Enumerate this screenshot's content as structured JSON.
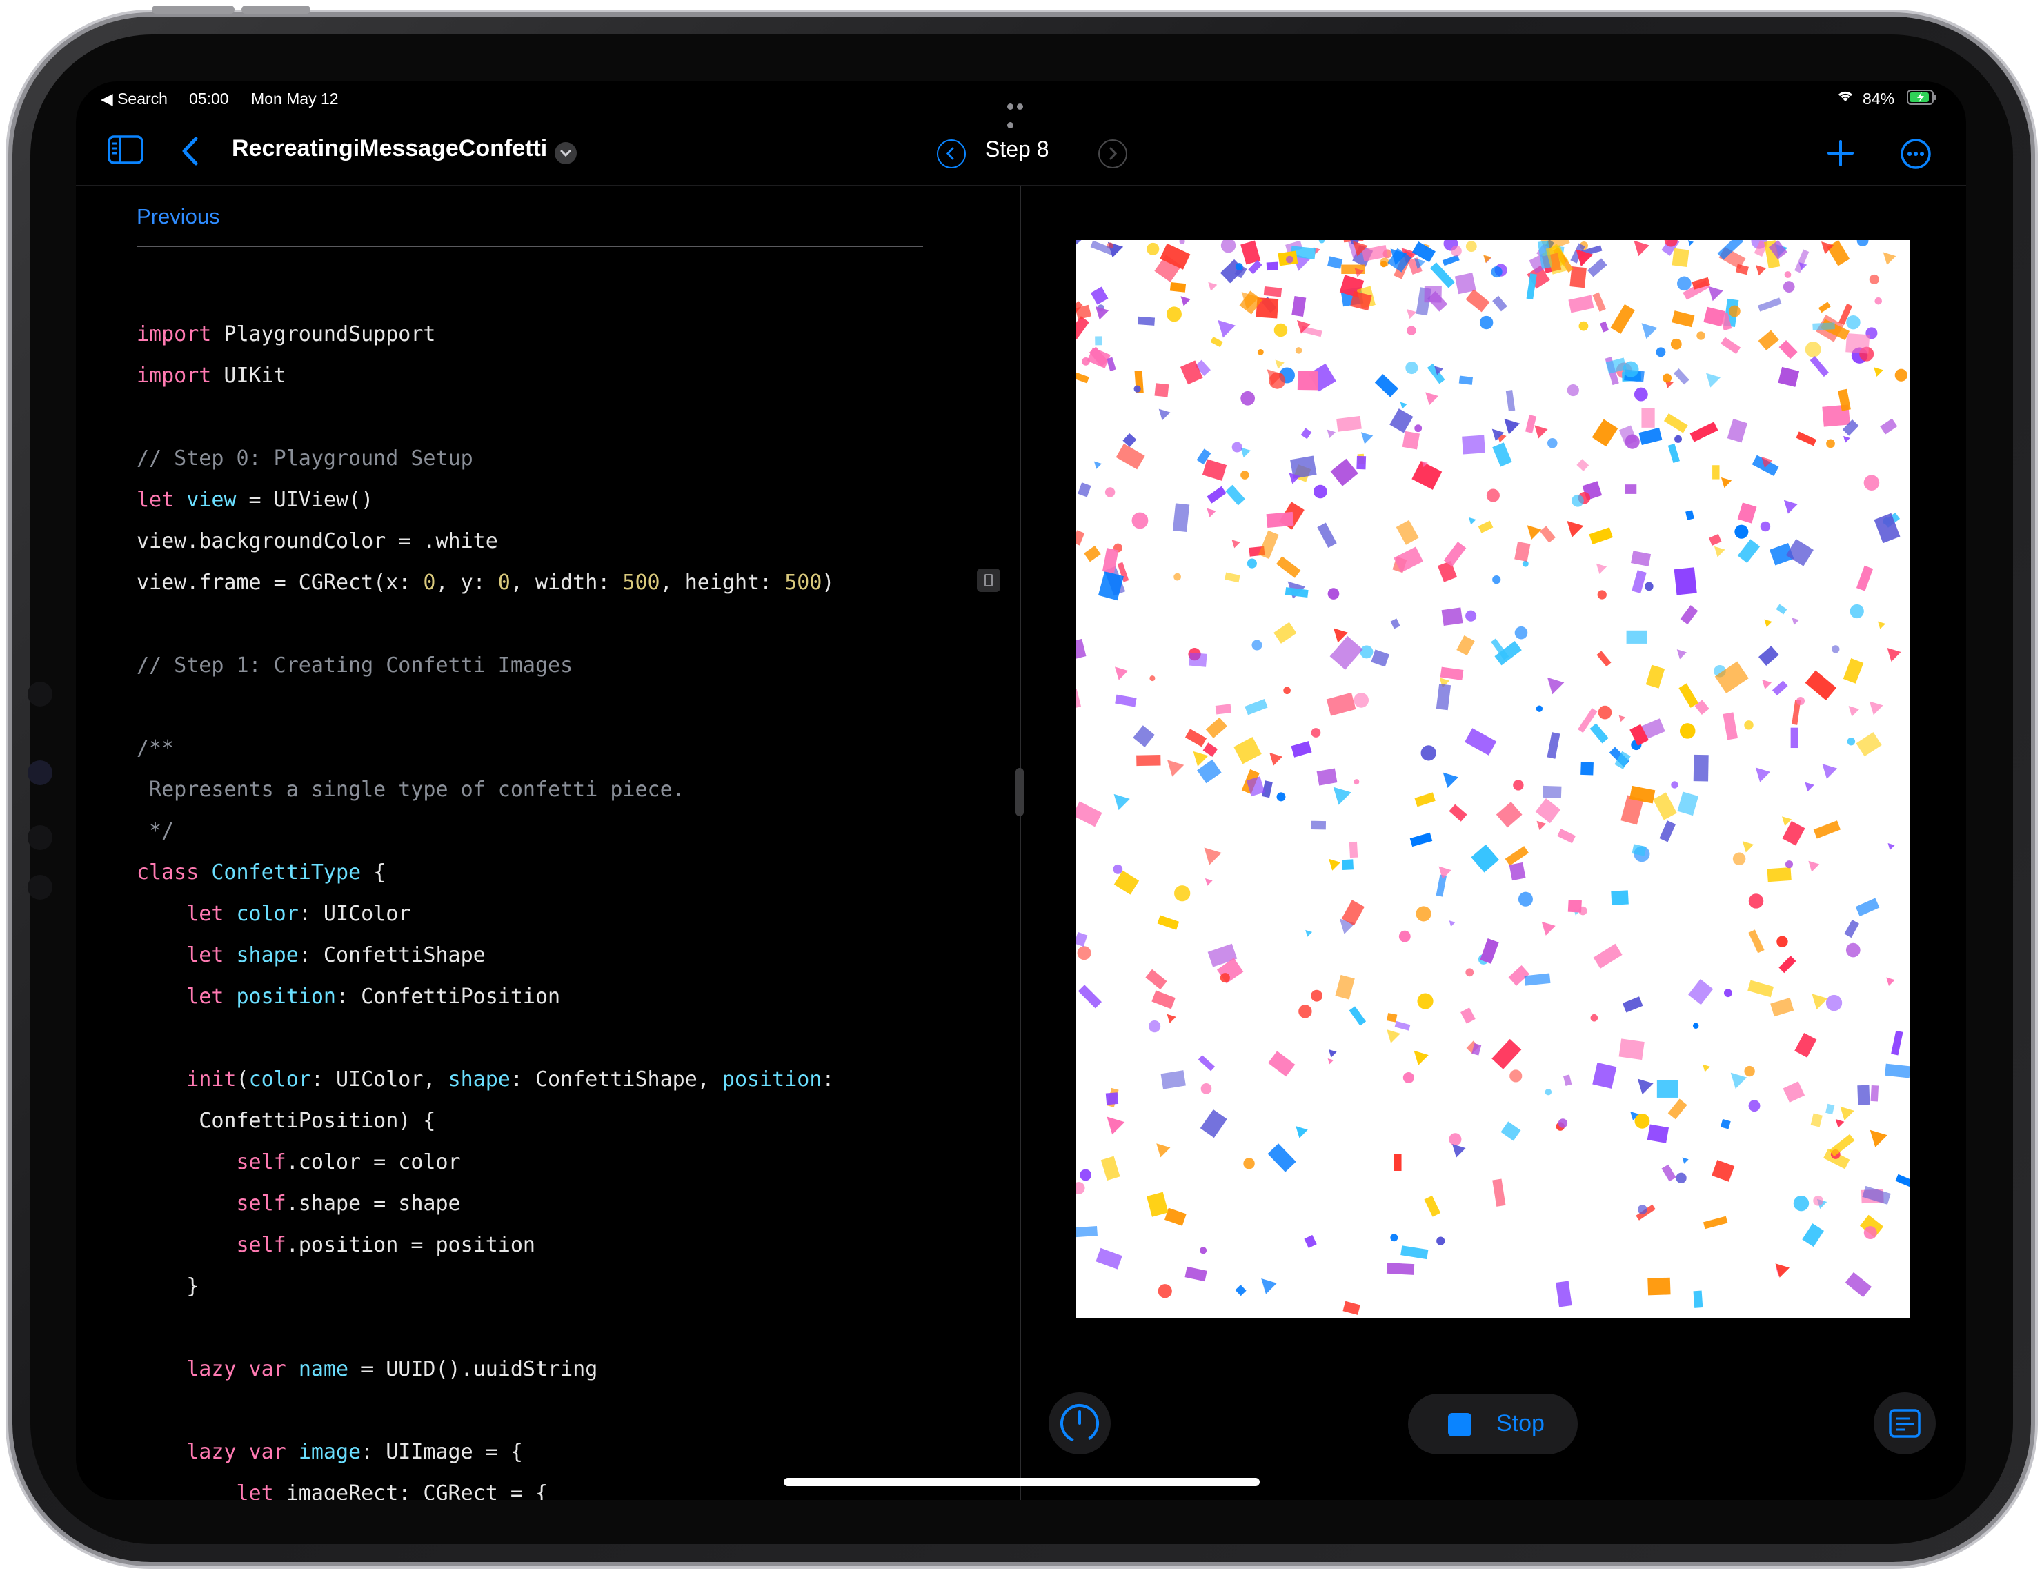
{
  "status_bar": {
    "back_app": "Search",
    "time": "05:00",
    "date": "Mon May 12",
    "battery": "84%"
  },
  "nav": {
    "title": "RecreatingiMessageConfetti",
    "step": "Step 8"
  },
  "editor": {
    "previous_link": "Previous",
    "lines": [
      [
        [
          "kw",
          "import"
        ],
        [
          "plain",
          " PlaygroundSupport"
        ]
      ],
      [
        [
          "kw",
          "import"
        ],
        [
          "plain",
          " UIKit"
        ]
      ],
      [],
      [
        [
          "cm",
          "// Step 0: Playground Setup"
        ]
      ],
      [
        [
          "kw",
          "let"
        ],
        [
          "plain",
          " "
        ],
        [
          "id",
          "view"
        ],
        [
          "plain",
          " = UIView()"
        ]
      ],
      [
        [
          "plain",
          "view.backgroundColor = .white"
        ]
      ],
      [
        [
          "plain",
          "view.frame = CGRect(x: "
        ],
        [
          "num",
          "0"
        ],
        [
          "plain",
          ", y: "
        ],
        [
          "num",
          "0"
        ],
        [
          "plain",
          ", width: "
        ],
        [
          "num",
          "500"
        ],
        [
          "plain",
          ", height: "
        ],
        [
          "num",
          "500"
        ],
        [
          "plain",
          ")"
        ]
      ],
      [],
      [
        [
          "cm",
          "// Step 1: Creating Confetti Images"
        ]
      ],
      [],
      [
        [
          "cm",
          "/**"
        ]
      ],
      [
        [
          "cm",
          " Represents a single type of confetti piece."
        ]
      ],
      [
        [
          "cm",
          " */"
        ]
      ],
      [
        [
          "kw",
          "class"
        ],
        [
          "plain",
          " "
        ],
        [
          "id",
          "ConfettiType"
        ],
        [
          "plain",
          " {"
        ]
      ],
      [
        [
          "plain",
          "    "
        ],
        [
          "kw",
          "let"
        ],
        [
          "plain",
          " "
        ],
        [
          "id",
          "color"
        ],
        [
          "plain",
          ": UIColor"
        ]
      ],
      [
        [
          "plain",
          "    "
        ],
        [
          "kw",
          "let"
        ],
        [
          "plain",
          " "
        ],
        [
          "id",
          "shape"
        ],
        [
          "plain",
          ": ConfettiShape"
        ]
      ],
      [
        [
          "plain",
          "    "
        ],
        [
          "kw",
          "let"
        ],
        [
          "plain",
          " "
        ],
        [
          "id",
          "position"
        ],
        [
          "plain",
          ": ConfettiPosition"
        ]
      ],
      [],
      [
        [
          "plain",
          "    "
        ],
        [
          "kw",
          "init"
        ],
        [
          "plain",
          "("
        ],
        [
          "id",
          "color"
        ],
        [
          "plain",
          ": UIColor, "
        ],
        [
          "id",
          "shape"
        ],
        [
          "plain",
          ": ConfettiShape, "
        ],
        [
          "id",
          "position"
        ],
        [
          "plain",
          ":"
        ]
      ],
      [
        [
          "plain",
          "     ConfettiPosition) {"
        ]
      ],
      [
        [
          "plain",
          "        "
        ],
        [
          "kw",
          "self"
        ],
        [
          "plain",
          ".color = color"
        ]
      ],
      [
        [
          "plain",
          "        "
        ],
        [
          "kw",
          "self"
        ],
        [
          "plain",
          ".shape = shape"
        ]
      ],
      [
        [
          "plain",
          "        "
        ],
        [
          "kw",
          "self"
        ],
        [
          "plain",
          ".position = position"
        ]
      ],
      [
        [
          "plain",
          "    }"
        ]
      ],
      [],
      [
        [
          "plain",
          "    "
        ],
        [
          "kw",
          "lazy"
        ],
        [
          "plain",
          " "
        ],
        [
          "kw",
          "var"
        ],
        [
          "plain",
          " "
        ],
        [
          "id",
          "name"
        ],
        [
          "plain",
          " = UUID().uuidString"
        ]
      ],
      [],
      [
        [
          "plain",
          "    "
        ],
        [
          "kw",
          "lazy"
        ],
        [
          "plain",
          " "
        ],
        [
          "kw",
          "var"
        ],
        [
          "plain",
          " "
        ],
        [
          "id",
          "image"
        ],
        [
          "plain",
          ": UIImage = {"
        ]
      ],
      [
        [
          "plain",
          "        "
        ],
        [
          "kw",
          "let"
        ],
        [
          "plain",
          " imageRect: CGRect = {"
        ]
      ]
    ]
  },
  "controls": {
    "stop_label": "Stop"
  },
  "icons": {
    "back": "chevron-left-icon",
    "sidebar": "sidebar-icon",
    "add": "plus-icon",
    "more": "ellipsis-circle-icon",
    "prev_step": "chevron-left-circle-icon",
    "next_step": "chevron-right-circle-icon",
    "gauge": "gauge-icon",
    "console": "console-icon"
  },
  "colors": {
    "accent": "#0a84ff",
    "keyword": "#ff7ab2",
    "type": "#6bdfff",
    "number": "#d9c97c",
    "comment": "#8a8f98",
    "confetti": [
      "#ff2d55",
      "#ff3b30",
      "#ff9500",
      "#ffcc00",
      "#5856d6",
      "#af52de",
      "#007aff",
      "#34c3ff",
      "#ff6fb5",
      "#8e44ff"
    ]
  }
}
